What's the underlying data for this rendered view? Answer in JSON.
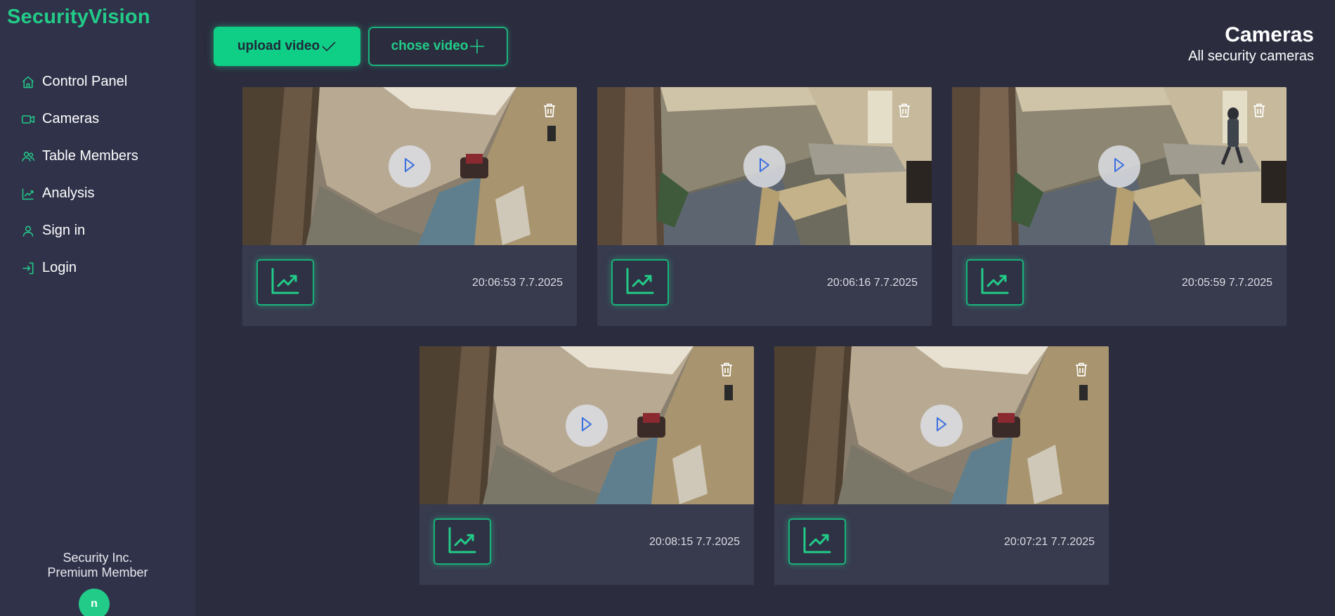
{
  "sidebar": {
    "brand": "SecurityVision",
    "items": [
      {
        "label": "Control Panel",
        "icon": "home-icon"
      },
      {
        "label": "Cameras",
        "icon": "video-camera-icon"
      },
      {
        "label": "Table Members",
        "icon": "users-icon"
      },
      {
        "label": "Analysis",
        "icon": "trend-chart-icon"
      },
      {
        "label": "Sign in",
        "icon": "user-icon"
      },
      {
        "label": "Login",
        "icon": "login-icon"
      }
    ],
    "company": "Security Inc.",
    "membership": "Premium Member",
    "avatar_initial": "n"
  },
  "toolbar": {
    "upload_label": "upload video",
    "chose_label": "chose video"
  },
  "header": {
    "title": "Cameras",
    "subtitle": "All security cameras"
  },
  "cards": [
    {
      "timestamp": "20:06:53 7.7.2025",
      "scene": "courtyard-vehicle"
    },
    {
      "timestamp": "20:06:16 7.7.2025",
      "scene": "doorway-pallet"
    },
    {
      "timestamp": "20:05:59 7.7.2025",
      "scene": "doorway-person"
    },
    {
      "timestamp": "20:08:15 7.7.2025",
      "scene": "courtyard-vehicle"
    },
    {
      "timestamp": "20:07:21 7.7.2025",
      "scene": "courtyard-vehicle"
    }
  ],
  "colors": {
    "accent": "#22cc88",
    "background": "#2b2d3f",
    "sidebar": "#30324a",
    "card": "#383a4e"
  }
}
